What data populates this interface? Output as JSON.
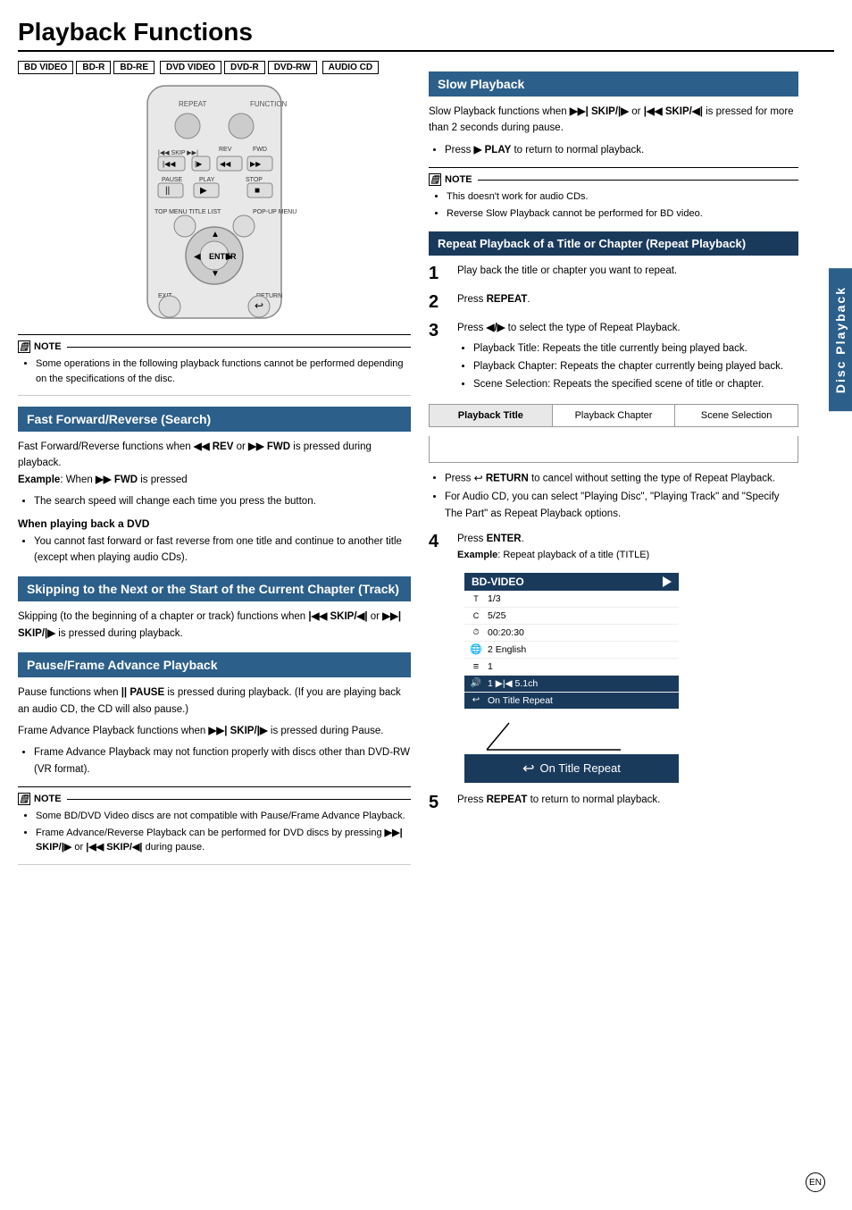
{
  "page": {
    "title": "Playback Functions",
    "formats": [
      "BD VIDEO",
      "BD-R",
      "BD-RE",
      "DVD VIDEO",
      "DVD-R",
      "DVD-RW",
      "AUDIO CD"
    ],
    "side_label": "Disc Playback",
    "page_num": "EN"
  },
  "note_main": {
    "label": "NOTE",
    "items": [
      "Some operations in the following playback functions cannot be performed depending on the specifications of the disc."
    ]
  },
  "fast_forward": {
    "header": "Fast Forward/Reverse (Search)",
    "body1": "Fast Forward/Reverse functions when ◀◀ REV or ▶▶ FWD is pressed during playback.",
    "example": "Example: When ▶▶ FWD is pressed",
    "bullets": [
      "The search speed will change each time you press the button."
    ],
    "dvd_header": "When playing back a DVD",
    "dvd_bullets": [
      "You cannot fast forward or fast reverse from one title and continue to another title (except when playing audio CDs)."
    ]
  },
  "skipping": {
    "header": "Skipping to the Next or the Start of the Current Chapter (Track)",
    "body": "Skipping (to the beginning of a chapter or track) functions when |◀◀ SKIP/◀| or ▶▶| SKIP/|▶ is pressed during playback."
  },
  "pause": {
    "header": "Pause/Frame Advance Playback",
    "body1": "Pause functions when || PAUSE is pressed during playback. (If you are playing back an audio CD, the CD will also pause.)",
    "body2": "Frame Advance Playback functions when ▶▶| SKIP/|▶ is pressed during Pause.",
    "bullets": [
      "Frame Advance Playback may not function properly with discs other than DVD-RW (VR format)."
    ],
    "note": {
      "label": "NOTE",
      "items": [
        "Some BD/DVD Video discs are not compatible with Pause/Frame Advance Playback.",
        "Frame Advance/Reverse Playback can be performed for DVD discs by pressing ▶▶| SKIP/|▶ or |◀◀ SKIP/◀| during pause."
      ]
    }
  },
  "slow_playback": {
    "header": "Slow Playback",
    "body": "Slow Playback functions when ▶▶| SKIP/|▶ or |◀◀ SKIP/◀| is pressed for more than 2 seconds during pause.",
    "bullets": [
      "Press ▶ PLAY to return to normal playback."
    ],
    "note": {
      "label": "NOTE",
      "items": [
        "This doesn't work for audio CDs.",
        "Reverse Slow Playback cannot be performed for BD video."
      ]
    }
  },
  "repeat_playback": {
    "header": "Repeat Playback of a Title or Chapter (Repeat Playback)",
    "steps": [
      {
        "num": "1",
        "text": "Play back the title or chapter you want to repeat."
      },
      {
        "num": "2",
        "text": "Press REPEAT."
      },
      {
        "num": "3",
        "text": "Press ◀/▶ to select the type of Repeat Playback.",
        "bullets": [
          "Playback Title: Repeats the title currently being played back.",
          "Playback Chapter: Repeats the chapter currently being played back.",
          "Scene Selection: Repeats the specified scene of title or chapter."
        ]
      }
    ],
    "selector": {
      "items": [
        "Playback Title",
        "Playback Chapter",
        "Scene Selection"
      ],
      "active": 0
    },
    "return_note": "Press ↩ RETURN to cancel without setting the type of Repeat Playback.",
    "audio_cd_note": "For Audio CD, you can select \"Playing Disc\", \"Playing Track\" and \"Specify The Part\" as Repeat Playback options.",
    "step4": {
      "num": "4",
      "text": "Press ENTER.",
      "example": "Example: Repeat playback of a title (TITLE)"
    },
    "bd_display": {
      "header": "BD-VIDEO",
      "rows": [
        {
          "icon": "T",
          "value": "1/3",
          "highlight": false
        },
        {
          "icon": "C",
          "value": "5/25",
          "highlight": false
        },
        {
          "icon": "⏱",
          "value": "00:20:30",
          "highlight": false
        },
        {
          "icon": "🌐",
          "value": "2 English",
          "highlight": false
        },
        {
          "icon": "≡",
          "value": "1",
          "highlight": false
        },
        {
          "icon": "🔊",
          "value": "1  ▶|◀  5.1ch",
          "highlight": true
        },
        {
          "icon": "↩",
          "value": "On Title Repeat",
          "highlight": true
        }
      ]
    },
    "on_title_repeat": "On Title Repeat",
    "step5": {
      "num": "5",
      "text": "Press REPEAT to return to normal playback."
    }
  }
}
